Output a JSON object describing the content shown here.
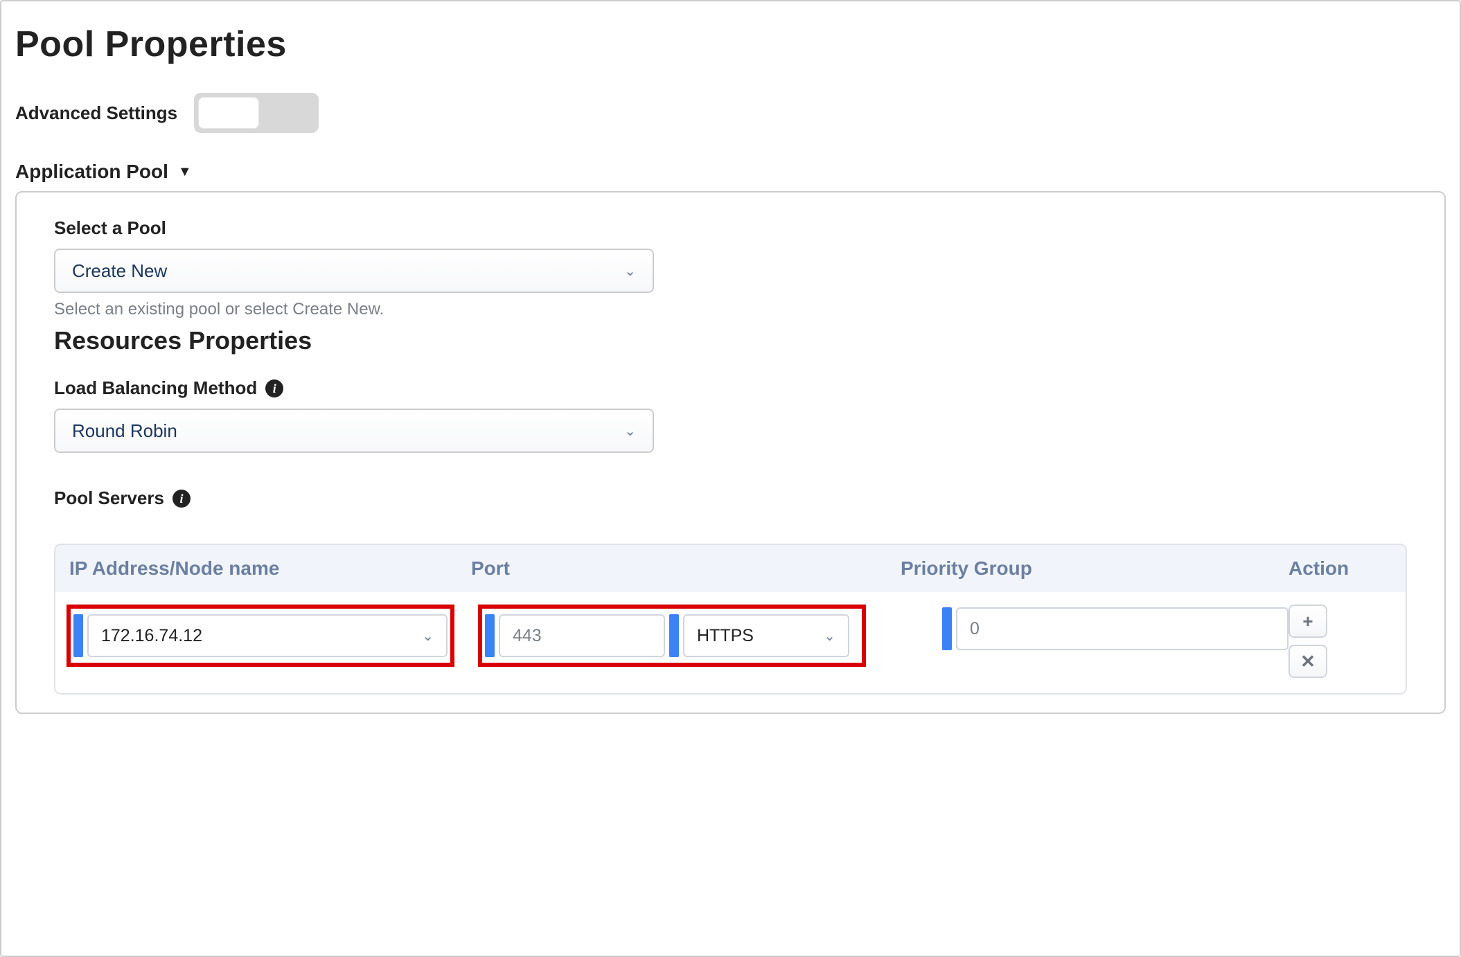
{
  "page": {
    "title": "Pool Properties"
  },
  "advanced": {
    "label": "Advanced Settings"
  },
  "section": {
    "title": "Application Pool"
  },
  "pool": {
    "select_label": "Select a Pool",
    "select_value": "Create New",
    "helper": "Select an existing pool or select Create New."
  },
  "resources": {
    "title": "Resources Properties",
    "lb_label": "Load Balancing Method",
    "lb_value": "Round Robin"
  },
  "servers": {
    "label": "Pool Servers",
    "columns": {
      "ip": "IP Address/Node name",
      "port": "Port",
      "priority": "Priority Group",
      "action": "Action"
    },
    "row": {
      "ip": "172.16.74.12",
      "port": "443",
      "protocol": "HTTPS",
      "priority": "0"
    },
    "actions": {
      "add": "+",
      "remove": "✕"
    }
  }
}
